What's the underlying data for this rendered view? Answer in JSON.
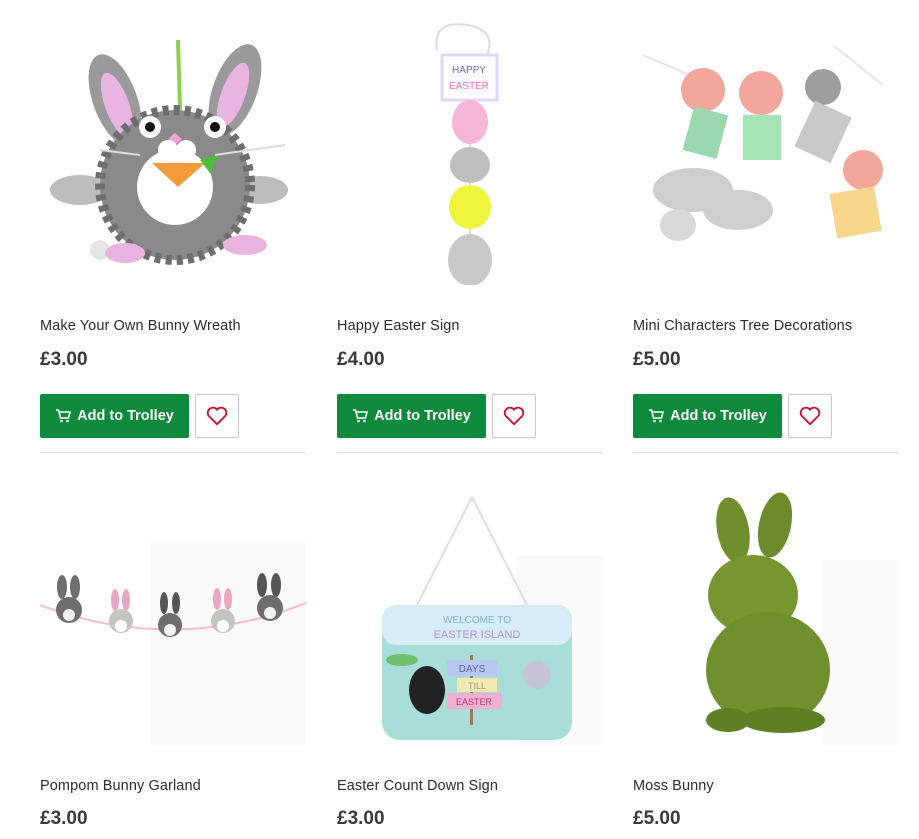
{
  "products": [
    {
      "name": "Make Your Own Bunny Wreath",
      "price": "£3.00",
      "add_label": "Add to Trolley",
      "image_icon": "bunny-wreath-image",
      "fav_icon": "heart-icon"
    },
    {
      "name": "Happy Easter Sign",
      "price": "£4.00",
      "add_label": "Add to Trolley",
      "image_icon": "easter-sign-image",
      "sign_text_1": "HAPPY",
      "sign_text_2": "EASTER",
      "fav_icon": "heart-icon"
    },
    {
      "name": "Mini Characters Tree Decorations",
      "price": "£5.00",
      "add_label": "Add to Trolley",
      "image_icon": "tree-decorations-image",
      "fav_icon": "heart-icon"
    },
    {
      "name": "Pompom Bunny Garland",
      "price": "£3.00",
      "image_icon": "bunny-garland-image"
    },
    {
      "name": "Easter Count Down Sign",
      "price": "£3.00",
      "image_icon": "countdown-sign-image",
      "sign_text_1": "WELCOME TO",
      "sign_text_2": "EASTER ISLAND",
      "sign_text_3": "DAYS",
      "sign_text_4": "TILL",
      "sign_text_5": "EASTER"
    },
    {
      "name": "Moss Bunny",
      "price": "£5.00",
      "image_icon": "moss-bunny-image"
    }
  ],
  "colors": {
    "button_green": "#0d8a3c",
    "heart_red": "#c8102e"
  }
}
